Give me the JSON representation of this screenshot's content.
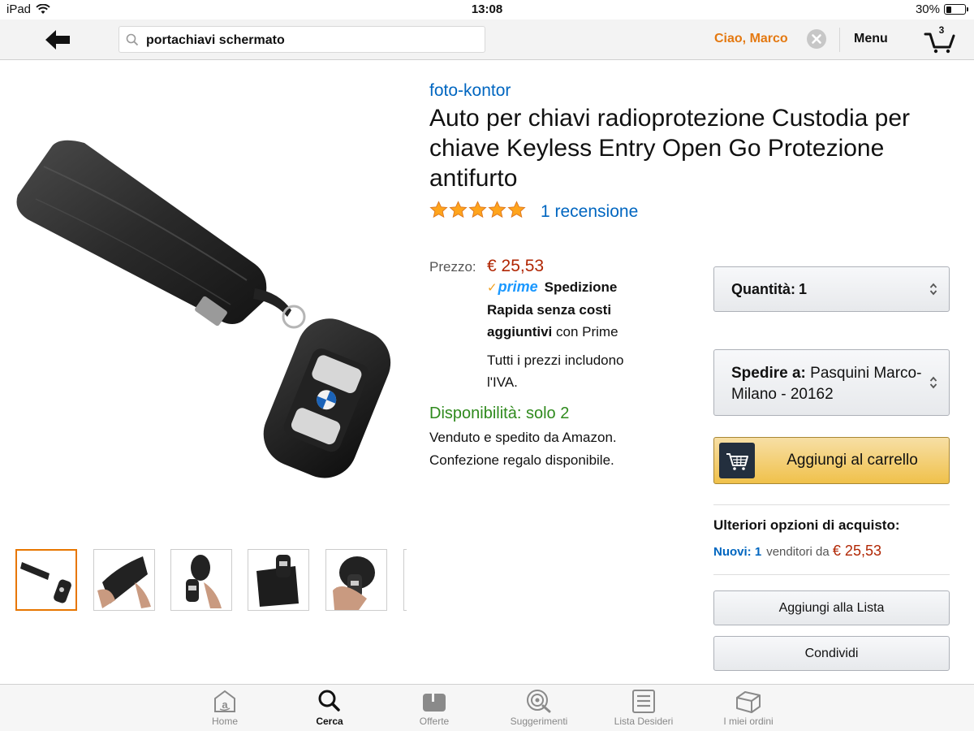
{
  "status_bar": {
    "device": "iPad",
    "time": "13:08",
    "battery": "30%",
    "battery_level": 0.3
  },
  "navbar": {
    "search_query": "portachiavi schermato",
    "greeting": "Ciao, Marco",
    "menu_label": "Menu",
    "cart_count": "3"
  },
  "product": {
    "brand": "foto-kontor",
    "title": "Auto per chiavi radioprotezione Custodia per chiave Keyless Entry Open Go Protezione antifurto",
    "rating_stars": 5,
    "reviews": "1 recensione",
    "price_label": "Prezzo:",
    "price": "€ 25,53",
    "prime_logo": "prime",
    "prime_bold": "Spedizione Rapida senza costi aggiuntivi",
    "prime_rest": "con Prime",
    "vat_note": "Tutti i prezzi includono l'IVA.",
    "availability": "Disponibilità: solo 2",
    "seller_line1": "Venduto e spedito da Amazon.",
    "seller_line2": "Confezione regalo disponibile."
  },
  "buy_box": {
    "quantity_label": "Quantità:",
    "quantity_value": "1",
    "ship_label": "Spedire a:",
    "ship_address": "Pasquini Marco- Milano - 20162",
    "add_to_cart": "Aggiungi al carrello",
    "more_options_title": "Ulteriori opzioni di acquisto:",
    "new_count": "Nuovi: 1",
    "sellers_from": "venditori da",
    "min_price": "€ 25,53",
    "add_to_list": "Aggiungi alla Lista",
    "share": "Condividi"
  },
  "colors": {
    "link": "#0066c0",
    "price": "#b12704",
    "greeting": "#e47911",
    "availability": "#2f8a1d",
    "cart_button": "#f0c14b",
    "prime": "#1a98ff"
  },
  "tabbar": {
    "tabs": [
      {
        "label": "Home",
        "icon": "home-icon",
        "active": false
      },
      {
        "label": "Cerca",
        "icon": "search-icon",
        "active": true
      },
      {
        "label": "Offerte",
        "icon": "deals-icon",
        "active": false
      },
      {
        "label": "Suggerimenti",
        "icon": "recommendations-icon",
        "active": false
      },
      {
        "label": "Lista Desideri",
        "icon": "wishlist-icon",
        "active": false
      },
      {
        "label": "I miei ordini",
        "icon": "orders-icon",
        "active": false
      }
    ]
  }
}
